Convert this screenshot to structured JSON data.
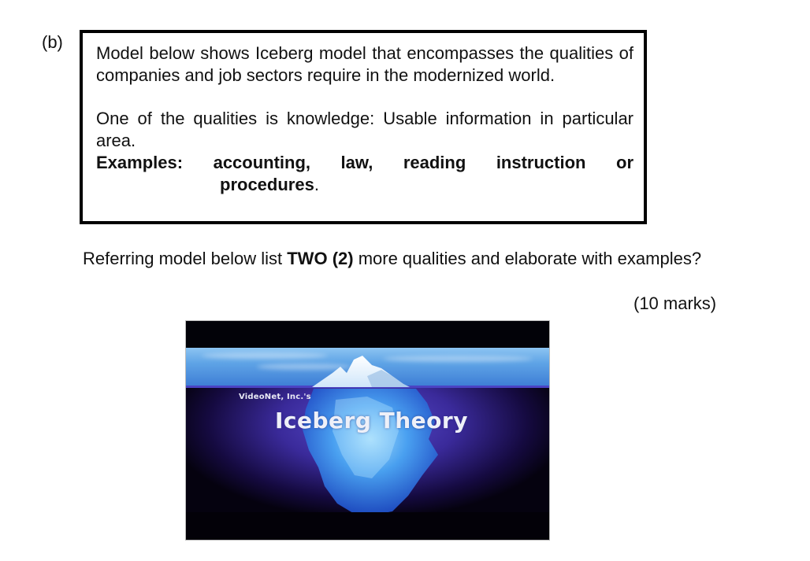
{
  "question": {
    "label": "(b)",
    "box": {
      "para1": "Model below shows Iceberg model that encompasses the qualities of companies and job sectors require in the modernized world.",
      "para2_line": "One of the qualities is knowledge: Usable information in particular area.",
      "examples_label": "Examples:",
      "examples_items": [
        "accounting,",
        "law,",
        "reading",
        "instruction",
        "or"
      ],
      "examples_cont": "procedures",
      "examples_period": "."
    },
    "prompt": {
      "before": "Referring model below list ",
      "bold1": "TWO",
      "space": " ",
      "bold2": "(2)",
      "after": " more qualities and elaborate with examples?"
    },
    "marks": "(10 marks)"
  },
  "figure": {
    "subtitle": "VideoNet, Inc.'s",
    "title": "Iceberg Theory",
    "colors": {
      "sky": "#5fa4e6",
      "water": "#3a2a9a",
      "ice": "#7cc8ff",
      "band": "#020208"
    }
  }
}
